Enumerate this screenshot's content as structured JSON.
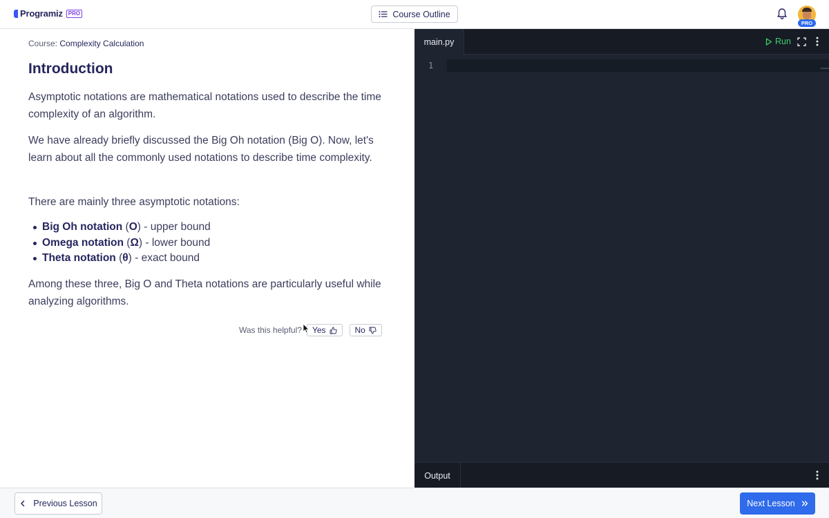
{
  "header": {
    "logo_text": "Programiz",
    "logo_badge": "PRO",
    "course_outline_label": "Course Outline",
    "avatar_badge": "PRO"
  },
  "lesson": {
    "breadcrumb_prefix": "Course:",
    "breadcrumb_course": "Complexity Calculation",
    "title": "Introduction",
    "paragraph1": "Asymptotic notations are mathematical notations used to describe the time complexity of an algorithm.",
    "paragraph2": "We have already briefly discussed the Big Oh notation (Big O). Now, let's learn about all the commonly used notations to describe time complexity.",
    "paragraph3": "There are mainly three asymptotic notations:",
    "notations": [
      {
        "name": "Big Oh notation",
        "symbol": "O",
        "description": "upper bound"
      },
      {
        "name": "Omega notation",
        "symbol": "Ω",
        "description": "lower bound"
      },
      {
        "name": "Theta notation",
        "symbol": "θ",
        "description": "exact bound"
      }
    ],
    "paragraph4": "Among these three, Big O and Theta notations are particularly useful while analyzing algorithms."
  },
  "feedback": {
    "question": "Was this helpful?",
    "yes_label": "Yes",
    "no_label": "No"
  },
  "editor": {
    "tab_label": "main.py",
    "run_label": "Run",
    "line_numbers": [
      "1"
    ],
    "output_label": "Output",
    "run_color": "#3ecf6e"
  },
  "footer": {
    "prev_label": "Previous Lesson",
    "next_label": "Next Lesson",
    "next_color": "#2f6bea"
  }
}
